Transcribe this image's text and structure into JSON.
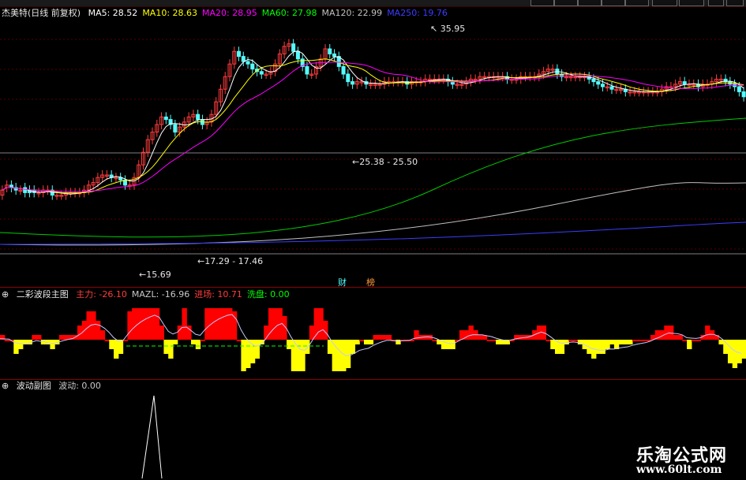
{
  "main": {
    "title": "杰美特(日线 前复权)",
    "ma": [
      {
        "label": "MA5:",
        "value": "28.52",
        "color": "#ffffff"
      },
      {
        "label": "MA10:",
        "value": "28.63",
        "color": "#ffff00"
      },
      {
        "label": "MA20:",
        "value": "28.95",
        "color": "#ff00ff"
      },
      {
        "label": "MA60:",
        "value": "27.98",
        "color": "#00ff00"
      },
      {
        "label": "MA120:",
        "value": "22.99",
        "color": "#c0c0c0"
      },
      {
        "label": "MA250:",
        "value": "19.76",
        "color": "#3c3cff"
      }
    ],
    "annotations": {
      "high": "35.95",
      "mid": "25.38 - 25.50",
      "low_range": "17.29 - 17.46",
      "low": "15.69"
    },
    "tags": {
      "fin1": "财",
      "fin2": "榜"
    }
  },
  "indicator": {
    "title": "二彩波段主图",
    "fields": [
      {
        "label": "主力:",
        "value": "-26.10",
        "color": "#ff3c3c"
      },
      {
        "label": "MAZL:",
        "value": "-16.96",
        "color": "#c8c8c8"
      },
      {
        "label": "进场:",
        "value": "10.71",
        "color": "#ff3c3c"
      },
      {
        "label": "洗盘:",
        "value": "0.00",
        "color": "#00ff00"
      }
    ]
  },
  "sub": {
    "title": "波动副图",
    "fields": [
      {
        "label": "波动:",
        "value": "0.00",
        "color": "#c8c8c8"
      }
    ]
  },
  "watermark": {
    "line1": "乐淘公式网",
    "line2": "www.60lt.com"
  },
  "colors": {
    "up": "#ff3c3c",
    "down": "#54fcfc",
    "bar_up": "#ff0000",
    "bar_down": "#ffff00"
  },
  "chart_data": {
    "type": "candlestick",
    "candles": [
      [
        32,
        34
      ],
      [
        35,
        36
      ],
      [
        36,
        35
      ],
      [
        35,
        34
      ],
      [
        34,
        34
      ],
      [
        35,
        33
      ],
      [
        34,
        33
      ],
      [
        34,
        33
      ],
      [
        33,
        33
      ],
      [
        33,
        34
      ],
      [
        34,
        34
      ],
      [
        34,
        32
      ],
      [
        32,
        32
      ],
      [
        32,
        32
      ],
      [
        32,
        33
      ],
      [
        33,
        33
      ],
      [
        33,
        33
      ],
      [
        33,
        33
      ],
      [
        33,
        34
      ],
      [
        34,
        36
      ],
      [
        36,
        37
      ],
      [
        37,
        39
      ],
      [
        39,
        40
      ],
      [
        40,
        40
      ],
      [
        40,
        39
      ],
      [
        39,
        39
      ],
      [
        39,
        38
      ],
      [
        38,
        36
      ],
      [
        36,
        36
      ],
      [
        36,
        39
      ],
      [
        39,
        44
      ],
      [
        44,
        49
      ],
      [
        49,
        54
      ],
      [
        54,
        57
      ],
      [
        57,
        60
      ],
      [
        60,
        63
      ],
      [
        63,
        62
      ],
      [
        62,
        60
      ],
      [
        60,
        57
      ],
      [
        57,
        59
      ],
      [
        59,
        61
      ],
      [
        61,
        63
      ],
      [
        63,
        64
      ],
      [
        64,
        62
      ],
      [
        62,
        60
      ],
      [
        60,
        61
      ],
      [
        61,
        64
      ],
      [
        64,
        69
      ],
      [
        69,
        74
      ],
      [
        74,
        79
      ],
      [
        79,
        84
      ],
      [
        84,
        89
      ],
      [
        89,
        87
      ],
      [
        87,
        85
      ],
      [
        85,
        84
      ],
      [
        84,
        82
      ],
      [
        82,
        81
      ],
      [
        81,
        80
      ],
      [
        80,
        80
      ],
      [
        80,
        81
      ],
      [
        81,
        84
      ],
      [
        84,
        88
      ],
      [
        88,
        91
      ],
      [
        91,
        92
      ],
      [
        92,
        89
      ],
      [
        89,
        86
      ],
      [
        86,
        83
      ],
      [
        83,
        80
      ],
      [
        80,
        80
      ],
      [
        80,
        83
      ],
      [
        83,
        86
      ],
      [
        86,
        90
      ],
      [
        90,
        88
      ],
      [
        88,
        87
      ],
      [
        87,
        83
      ],
      [
        83,
        80
      ],
      [
        80,
        77
      ],
      [
        77,
        76
      ],
      [
        76,
        77
      ],
      [
        77,
        77
      ],
      [
        77,
        76
      ],
      [
        76,
        76
      ],
      [
        76,
        76
      ],
      [
        76,
        76
      ],
      [
        76,
        77
      ],
      [
        77,
        77
      ],
      [
        77,
        77
      ],
      [
        77,
        77
      ],
      [
        77,
        77
      ],
      [
        77,
        76
      ],
      [
        76,
        77
      ],
      [
        77,
        77
      ],
      [
        77,
        77
      ],
      [
        77,
        78
      ],
      [
        78,
        78
      ],
      [
        78,
        78
      ],
      [
        78,
        78
      ],
      [
        78,
        78
      ],
      [
        78,
        77
      ],
      [
        77,
        76
      ],
      [
        76,
        76
      ],
      [
        76,
        76
      ],
      [
        76,
        77
      ],
      [
        77,
        78
      ],
      [
        78,
        78
      ],
      [
        78,
        79
      ],
      [
        79,
        79
      ],
      [
        79,
        79
      ],
      [
        79,
        79
      ],
      [
        79,
        79
      ],
      [
        79,
        79
      ],
      [
        79,
        78
      ],
      [
        78,
        78
      ],
      [
        78,
        78
      ],
      [
        78,
        79
      ],
      [
        79,
        79
      ],
      [
        79,
        79
      ],
      [
        79,
        79
      ],
      [
        79,
        80
      ],
      [
        80,
        81
      ],
      [
        81,
        82
      ],
      [
        82,
        82
      ],
      [
        82,
        80
      ],
      [
        80,
        79
      ],
      [
        79,
        79
      ],
      [
        79,
        79
      ],
      [
        79,
        79
      ],
      [
        79,
        79
      ],
      [
        79,
        79
      ],
      [
        79,
        78
      ],
      [
        78,
        77
      ],
      [
        77,
        76
      ],
      [
        76,
        75
      ],
      [
        75,
        75
      ],
      [
        75,
        74
      ],
      [
        74,
        74
      ],
      [
        74,
        74
      ],
      [
        74,
        73
      ],
      [
        73,
        73
      ],
      [
        73,
        73
      ],
      [
        73,
        73
      ],
      [
        73,
        73
      ],
      [
        73,
        73
      ],
      [
        73,
        73
      ],
      [
        73,
        73
      ],
      [
        73,
        74
      ],
      [
        74,
        75
      ],
      [
        75,
        75
      ],
      [
        75,
        76
      ],
      [
        76,
        77
      ],
      [
        77,
        76
      ],
      [
        76,
        76
      ],
      [
        76,
        76
      ],
      [
        76,
        75
      ],
      [
        75,
        76
      ],
      [
        76,
        76
      ],
      [
        76,
        77
      ],
      [
        77,
        78
      ],
      [
        78,
        78
      ],
      [
        78,
        77
      ],
      [
        77,
        76
      ],
      [
        76,
        75
      ],
      [
        75,
        73
      ],
      [
        73,
        71
      ]
    ]
  }
}
